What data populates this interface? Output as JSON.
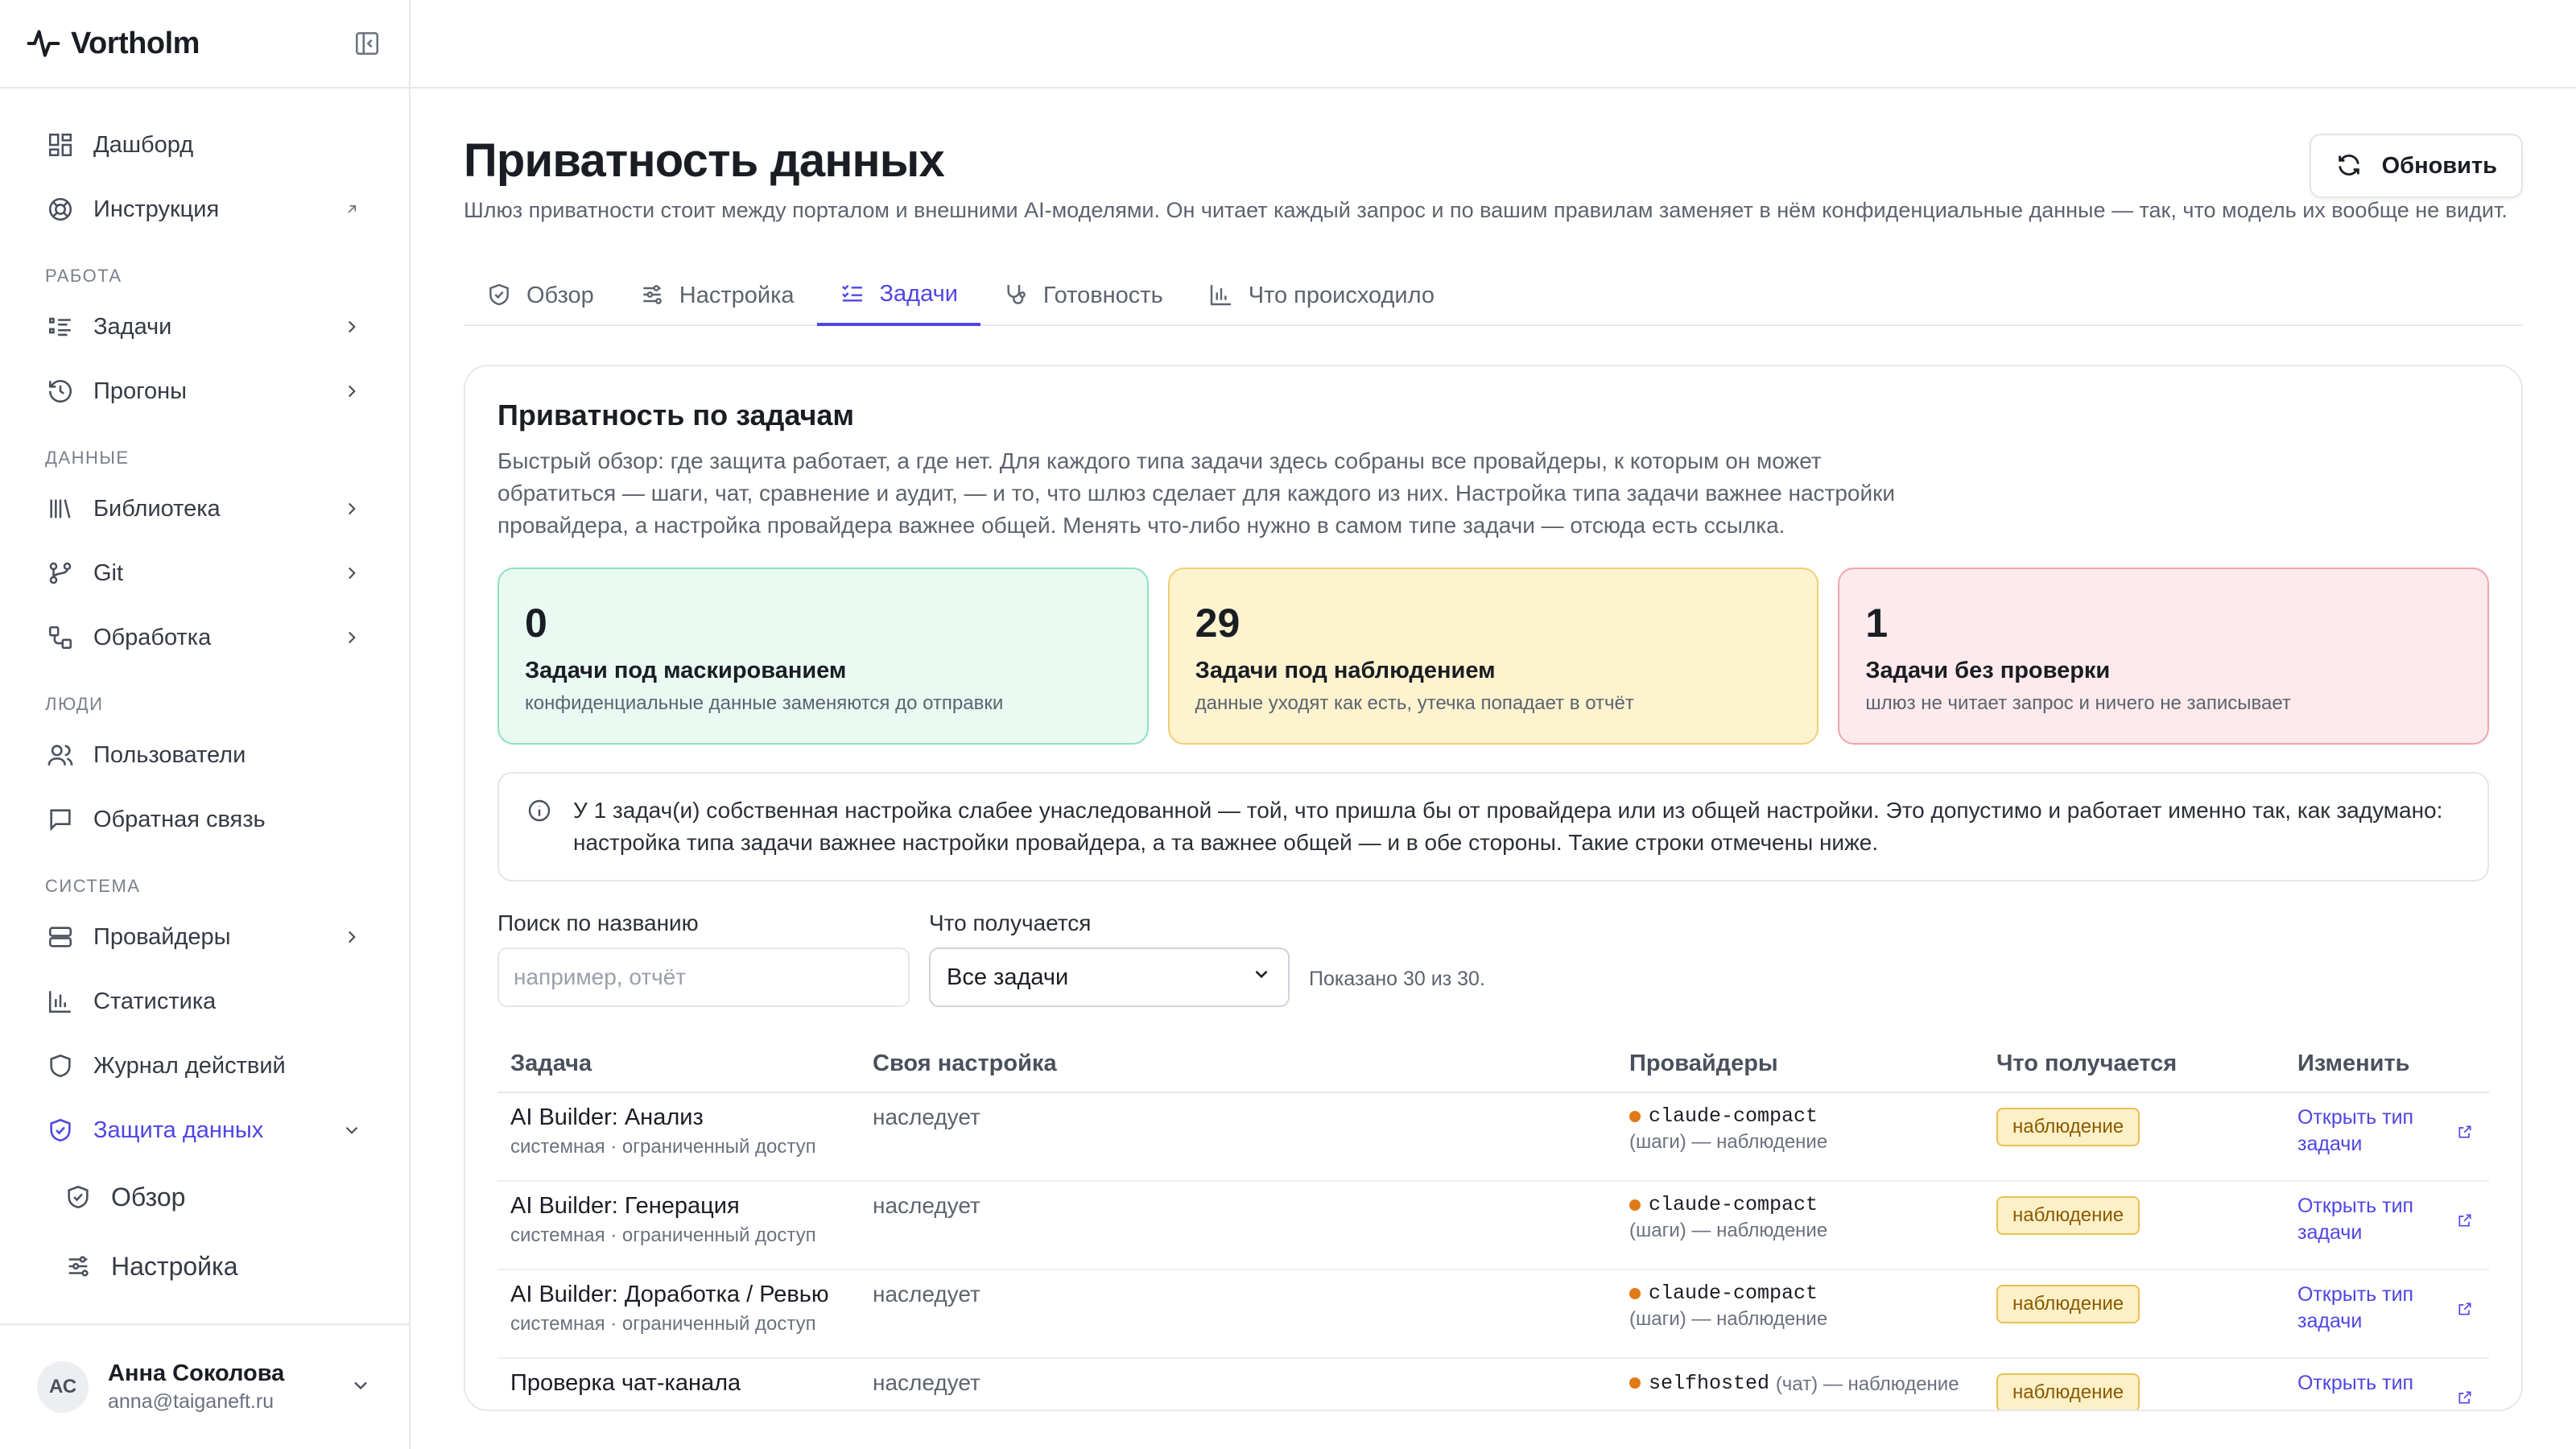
{
  "brand": {
    "name": "Vortholm"
  },
  "nav": {
    "top": [
      {
        "label": "Дашборд",
        "icon": "dashboard-icon"
      },
      {
        "label": "Инструкция",
        "icon": "lifebuoy-icon"
      }
    ],
    "sections": [
      {
        "title": "РАБОТА",
        "items": [
          {
            "label": "Задачи",
            "icon": "task-list-icon"
          },
          {
            "label": "Прогоны",
            "icon": "history-icon"
          }
        ]
      },
      {
        "title": "ДАННЫЕ",
        "items": [
          {
            "label": "Библиотека",
            "icon": "library-icon"
          },
          {
            "label": "Git",
            "icon": "git-branch-icon"
          },
          {
            "label": "Обработка",
            "icon": "workflow-icon"
          }
        ]
      },
      {
        "title": "ЛЮДИ",
        "items": [
          {
            "label": "Пользователи",
            "icon": "users-icon"
          },
          {
            "label": "Обратная связь",
            "icon": "message-icon"
          }
        ]
      },
      {
        "title": "СИСТЕМА",
        "items": [
          {
            "label": "Провайдеры",
            "icon": "server-icon"
          },
          {
            "label": "Статистика",
            "icon": "bar-chart-icon"
          },
          {
            "label": "Журнал действий",
            "icon": "shield-icon"
          },
          {
            "label": "Защита данных",
            "icon": "shield-check-icon"
          },
          {
            "label": "Обзор",
            "icon": "shield-check-icon"
          },
          {
            "label": "Настройка",
            "icon": "sliders-icon"
          }
        ]
      }
    ]
  },
  "user": {
    "initials": "АС",
    "name": "Анна Соколова",
    "email": "anna@taiganeft.ru"
  },
  "page": {
    "title": "Приватность данных",
    "description": "Шлюз приватности стоит между порталом и внешними AI-моделями. Он читает каждый запрос и по вашим правилам заменяет в нём конфиденциальные данные — так, что модель их вообще не видит.",
    "refresh_label": "Обновить"
  },
  "tabs": [
    {
      "label": "Обзор",
      "icon": "shield-check-icon"
    },
    {
      "label": "Настройка",
      "icon": "sliders-icon"
    },
    {
      "label": "Задачи",
      "icon": "checklist-icon"
    },
    {
      "label": "Готовность",
      "icon": "stethoscope-icon"
    },
    {
      "label": "Что происходило",
      "icon": "bar-chart-icon"
    }
  ],
  "card": {
    "title": "Приватность по задачам",
    "description": "Быстрый обзор: где защита работает, а где нет. Для каждого типа задачи здесь собраны все провайдеры, к которым он может обратиться — шаги, чат, сравнение и аудит, — и то, что шлюз сделает для каждого из них. Настройка типа задачи важнее настройки провайдера, а настройка провайдера важнее общей. Менять что-либо нужно в самом типе задачи — отсюда есть ссылка."
  },
  "stats": [
    {
      "value": "0",
      "label": "Задачи под маскированием",
      "sub": "конфиденциальные данные заменяются до отправки"
    },
    {
      "value": "29",
      "label": "Задачи под наблюдением",
      "sub": "данные уходят как есть, утечка попадает в отчёт"
    },
    {
      "value": "1",
      "label": "Задачи без проверки",
      "sub": "шлюз не читает запрос и ничего не записывает"
    }
  ],
  "info": "У 1 задач(и) собственная настройка слабее унаследованной — той, что пришла бы от провайдера или из общей настройки. Это допустимо и работает именно так, как задумано: настройка типа задачи важнее настройки провайдера, а та важнее общей — и в обе стороны. Такие строки отмечены ниже.",
  "filters": {
    "search_label": "Поиск по названию",
    "search_placeholder": "например, отчёт",
    "result_label": "Что получается",
    "result_value": "Все задачи",
    "count_text": "Показано 30 из 30."
  },
  "table": {
    "headers": [
      "Задача",
      "Своя настройка",
      "Провайдеры",
      "Что получается",
      "Изменить"
    ],
    "rows": [
      {
        "name": "AI Builder: Анализ",
        "sub": "системная · ограниченный доступ",
        "own": "наследует",
        "provider": "claude-compact",
        "provider_note": "(шаги) — наблюдение",
        "result": "наблюдение",
        "edit": "Открыть тип задачи"
      },
      {
        "name": "AI Builder: Генерация",
        "sub": "системная · ограниченный доступ",
        "own": "наследует",
        "provider": "claude-compact",
        "provider_note": "(шаги) — наблюдение",
        "result": "наблюдение",
        "edit": "Открыть тип задачи"
      },
      {
        "name": "AI Builder: Доработка / Ревью",
        "sub": "системная · ограниченный доступ",
        "own": "наследует",
        "provider": "claude-compact",
        "provider_note": "(шаги) — наблюдение",
        "result": "наблюдение",
        "edit": "Открыть тип задачи"
      },
      {
        "name": "Проверка чат-канала",
        "sub": "",
        "own": "наследует",
        "provider": "selfhosted",
        "provider_note": "(чат) — наблюдение",
        "result": "наблюдение",
        "edit": "Открыть тип"
      }
    ]
  }
}
